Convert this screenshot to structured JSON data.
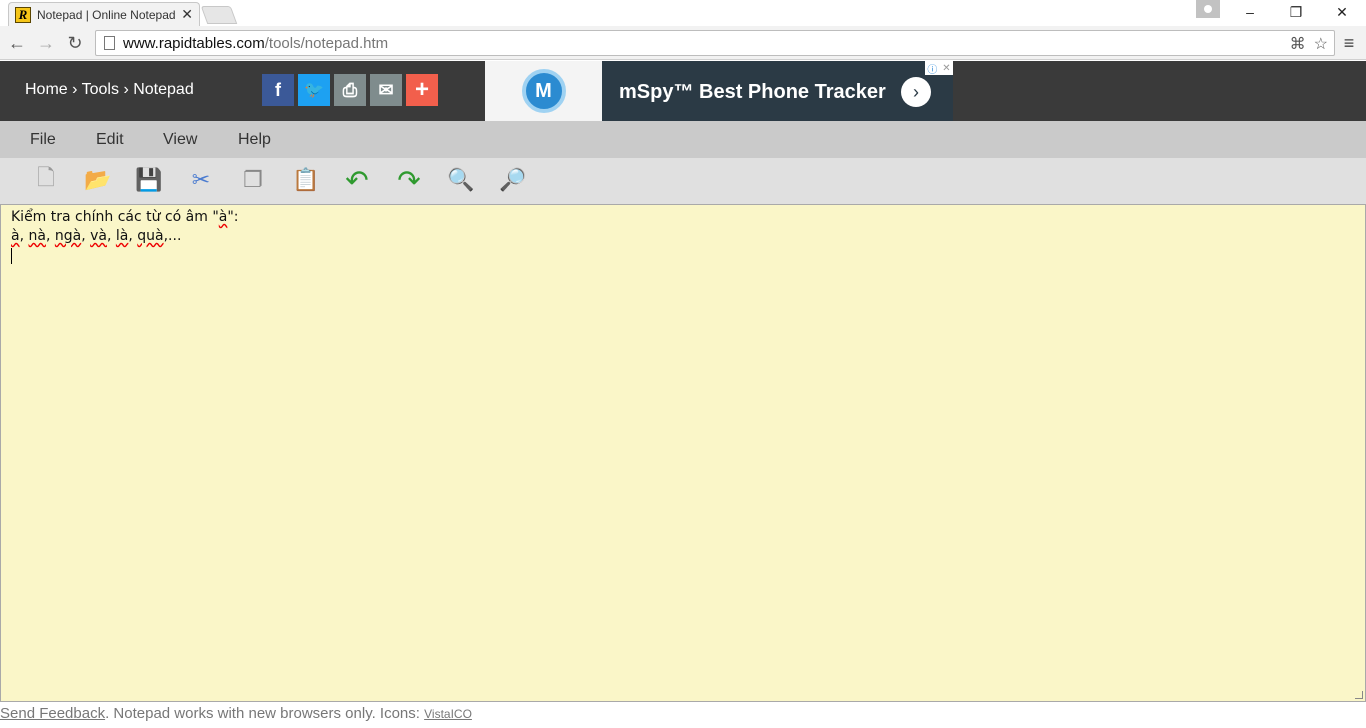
{
  "browser": {
    "tab_title": "Notepad | Online Notepad",
    "tab_close": "✕",
    "url_host": "www.rapidtables.com",
    "url_path": "/tools/notepad.htm",
    "window_controls": [
      "–",
      "❐",
      "✕"
    ]
  },
  "site": {
    "breadcrumb": [
      "Home",
      "Tools",
      "Notepad"
    ],
    "breadcrumb_separator": "›",
    "share_buttons": [
      {
        "name": "facebook-icon",
        "glyph": "f",
        "color": "#3b5998"
      },
      {
        "name": "twitter-icon",
        "glyph": "🐦",
        "color": "#1da1f2"
      },
      {
        "name": "print-icon",
        "glyph": "⎙",
        "color": "#7f8c8d"
      },
      {
        "name": "email-icon",
        "glyph": "✉",
        "color": "#7f8c8d"
      },
      {
        "name": "plus-icon",
        "glyph": "+",
        "color": "#f25f4c"
      }
    ],
    "ad": {
      "logo_letter": "M",
      "text": "mSpy™ Best Phone Tracker",
      "arrow": "›"
    }
  },
  "menu": {
    "items": [
      "File",
      "Edit",
      "View",
      "Help"
    ]
  },
  "toolbar_icons": [
    {
      "name": "new-file-icon",
      "glyph": "🗋"
    },
    {
      "name": "open-file-icon",
      "glyph": "📂"
    },
    {
      "name": "save-icon",
      "glyph": "💾"
    },
    {
      "name": "cut-icon",
      "glyph": "✂"
    },
    {
      "name": "copy-icon",
      "glyph": "❐"
    },
    {
      "name": "paste-icon",
      "glyph": "📋"
    },
    {
      "name": "undo-icon",
      "glyph": "↶"
    },
    {
      "name": "redo-icon",
      "glyph": "↷"
    },
    {
      "name": "zoom-out-icon",
      "glyph": "🔍"
    },
    {
      "name": "zoom-in-icon",
      "glyph": "🔎"
    }
  ],
  "editor": {
    "line1_prefix": "Kiểm tra chính các từ có âm \"",
    "line1_word": "à",
    "line1_suffix": "\":",
    "line2_words": [
      "à",
      "nà",
      "ngà",
      "và",
      "là",
      "quà"
    ],
    "line2_tail": ",..."
  },
  "footer": {
    "feedback_link": "Send Feedback",
    "note": ".   Notepad works with new browsers only. Icons: ",
    "icons_link": "VistaICO"
  }
}
